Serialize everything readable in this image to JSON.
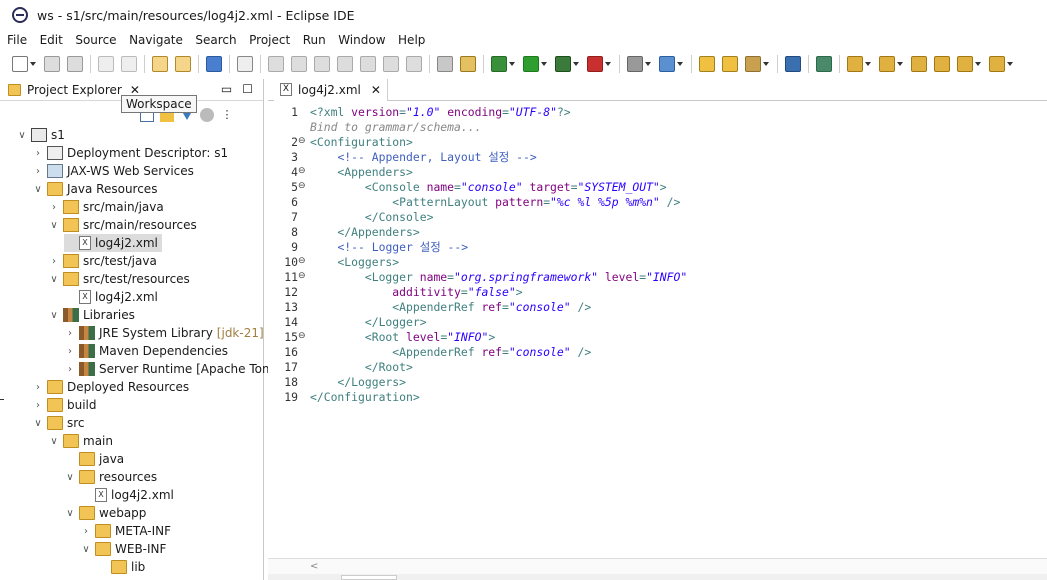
{
  "window": {
    "title": "ws - s1/src/main/resources/log4j2.xml - Eclipse IDE"
  },
  "menu": [
    "File",
    "Edit",
    "Source",
    "Navigate",
    "Search",
    "Project",
    "Run",
    "Window",
    "Help"
  ],
  "explorer": {
    "title": "Project Explorer",
    "tooltip": "Workspace"
  },
  "tree": [
    {
      "label": "s1",
      "depth": 0,
      "twisty": "v",
      "icon": "project-icon"
    },
    {
      "label": "Deployment Descriptor: s1",
      "depth": 1,
      "twisty": ">",
      "icon": "deployment-descriptor-icon"
    },
    {
      "label": "JAX-WS Web Services",
      "depth": 1,
      "twisty": ">",
      "icon": "web-services-icon"
    },
    {
      "label": "Java Resources",
      "depth": 1,
      "twisty": "v",
      "icon": "java-resources-icon"
    },
    {
      "label": "src/main/java",
      "depth": 2,
      "twisty": ">",
      "icon": "source-folder-icon"
    },
    {
      "label": "src/main/resources",
      "depth": 2,
      "twisty": "v",
      "icon": "source-folder-icon"
    },
    {
      "label": "log4j2.xml",
      "depth": 3,
      "twisty": "",
      "icon": "xml-file-icon",
      "selected": true
    },
    {
      "label": "src/test/java",
      "depth": 2,
      "twisty": ">",
      "icon": "source-folder-icon"
    },
    {
      "label": "src/test/resources",
      "depth": 2,
      "twisty": "v",
      "icon": "source-folder-icon"
    },
    {
      "label": "log4j2.xml",
      "depth": 3,
      "twisty": "",
      "icon": "xml-file-icon"
    },
    {
      "label": "Libraries",
      "depth": 2,
      "twisty": "v",
      "icon": "library-icon"
    },
    {
      "label": "JRE System Library",
      "extra": "[jdk-21]",
      "depth": 3,
      "twisty": ">",
      "icon": "library-icon"
    },
    {
      "label": "Maven Dependencies",
      "depth": 3,
      "twisty": ">",
      "icon": "library-icon"
    },
    {
      "label": "Server Runtime [Apache Tomc",
      "depth": 3,
      "twisty": ">",
      "icon": "library-icon"
    },
    {
      "label": "Deployed Resources",
      "depth": 1,
      "twisty": ">",
      "icon": "folder-icon"
    },
    {
      "label": "build",
      "depth": 1,
      "twisty": ">",
      "icon": "folder-icon"
    },
    {
      "label": "src",
      "depth": 1,
      "twisty": "v",
      "icon": "folder-icon"
    },
    {
      "label": "main",
      "depth": 2,
      "twisty": "v",
      "icon": "folder-icon"
    },
    {
      "label": "java",
      "depth": 3,
      "twisty": "",
      "icon": "folder-icon"
    },
    {
      "label": "resources",
      "depth": 3,
      "twisty": "v",
      "icon": "folder-icon"
    },
    {
      "label": "log4j2.xml",
      "depth": 4,
      "twisty": "",
      "icon": "xml-file-icon"
    },
    {
      "label": "webapp",
      "depth": 3,
      "twisty": "v",
      "icon": "folder-icon"
    },
    {
      "label": "META-INF",
      "depth": 4,
      "twisty": ">",
      "icon": "folder-icon"
    },
    {
      "label": "WEB-INF",
      "depth": 4,
      "twisty": "v",
      "icon": "folder-icon"
    },
    {
      "label": "lib",
      "depth": 5,
      "twisty": "",
      "icon": "folder-icon"
    }
  ],
  "editor": {
    "tab": "log4j2.xml",
    "lines": [
      {
        "n": "1",
        "fold": "",
        "parts": [
          [
            "tag",
            "<?"
          ],
          [
            "tag",
            "xml "
          ],
          [
            "attr",
            "version"
          ],
          [
            "tag",
            "="
          ],
          [
            "val",
            "\"1.0\""
          ],
          [
            "tag",
            " "
          ],
          [
            "attr",
            "encoding"
          ],
          [
            "tag",
            "="
          ],
          [
            "val",
            "\"UTF-8\""
          ],
          [
            "tag",
            "?>"
          ]
        ]
      },
      {
        "n": "",
        "fold": "",
        "parts": [
          [
            "hint",
            "Bind to grammar/schema..."
          ]
        ]
      },
      {
        "n": "2",
        "fold": "⊖",
        "parts": [
          [
            "tag",
            "<Configuration>"
          ]
        ]
      },
      {
        "n": "3",
        "fold": "",
        "parts": [
          [
            "tag",
            "    "
          ],
          [
            "com",
            "<!-- Appender, Layout 설정 -->"
          ]
        ]
      },
      {
        "n": "4",
        "fold": "⊖",
        "parts": [
          [
            "tag",
            "    <Appenders>"
          ]
        ]
      },
      {
        "n": "5",
        "fold": "⊖",
        "parts": [
          [
            "tag",
            "        <Console "
          ],
          [
            "attr",
            "name"
          ],
          [
            "tag",
            "="
          ],
          [
            "val",
            "\"console\""
          ],
          [
            "tag",
            " "
          ],
          [
            "attr",
            "target"
          ],
          [
            "tag",
            "="
          ],
          [
            "val",
            "\"SYSTEM_OUT\""
          ],
          [
            "tag",
            ">"
          ]
        ]
      },
      {
        "n": "6",
        "fold": "",
        "parts": [
          [
            "tag",
            "            <PatternLayout "
          ],
          [
            "attr",
            "pattern"
          ],
          [
            "tag",
            "="
          ],
          [
            "val",
            "\"%c %l %5p %m%n\""
          ],
          [
            "tag",
            " />"
          ]
        ]
      },
      {
        "n": "7",
        "fold": "",
        "parts": [
          [
            "tag",
            "        </Console>"
          ]
        ]
      },
      {
        "n": "8",
        "fold": "",
        "parts": [
          [
            "tag",
            "    </Appenders>"
          ]
        ]
      },
      {
        "n": "9",
        "fold": "",
        "parts": [
          [
            "tag",
            "    "
          ],
          [
            "com",
            "<!-- Logger 설정 -->"
          ]
        ]
      },
      {
        "n": "10",
        "fold": "⊖",
        "parts": [
          [
            "tag",
            "    <Loggers>"
          ]
        ]
      },
      {
        "n": "11",
        "fold": "⊖",
        "parts": [
          [
            "tag",
            "        <Logger "
          ],
          [
            "attr",
            "name"
          ],
          [
            "tag",
            "="
          ],
          [
            "val",
            "\"org.springframework\""
          ],
          [
            "tag",
            " "
          ],
          [
            "attr",
            "level"
          ],
          [
            "tag",
            "="
          ],
          [
            "val",
            "\"INFO\""
          ]
        ]
      },
      {
        "n": "12",
        "fold": "",
        "parts": [
          [
            "tag",
            "            "
          ],
          [
            "attr",
            "additivity"
          ],
          [
            "tag",
            "="
          ],
          [
            "val",
            "\"false\""
          ],
          [
            "tag",
            ">"
          ]
        ]
      },
      {
        "n": "13",
        "fold": "",
        "parts": [
          [
            "tag",
            "            <AppenderRef "
          ],
          [
            "attr",
            "ref"
          ],
          [
            "tag",
            "="
          ],
          [
            "val",
            "\"console\""
          ],
          [
            "tag",
            " />"
          ]
        ]
      },
      {
        "n": "14",
        "fold": "",
        "parts": [
          [
            "tag",
            "        </Logger>"
          ]
        ]
      },
      {
        "n": "15",
        "fold": "⊖",
        "parts": [
          [
            "tag",
            "        <Root "
          ],
          [
            "attr",
            "level"
          ],
          [
            "tag",
            "="
          ],
          [
            "val",
            "\"INFO\""
          ],
          [
            "tag",
            ">"
          ]
        ]
      },
      {
        "n": "16",
        "fold": "",
        "parts": [
          [
            "tag",
            "            <AppenderRef "
          ],
          [
            "attr",
            "ref"
          ],
          [
            "tag",
            "="
          ],
          [
            "val",
            "\"console\""
          ],
          [
            "tag",
            " />"
          ]
        ]
      },
      {
        "n": "17",
        "fold": "",
        "parts": [
          [
            "tag",
            "        </Root>"
          ]
        ]
      },
      {
        "n": "18",
        "fold": "",
        "parts": [
          [
            "tag",
            "    </Loggers>"
          ]
        ]
      },
      {
        "n": "19",
        "fold": "",
        "parts": [
          [
            "tag",
            "</Configuration>"
          ]
        ]
      }
    ]
  },
  "colors": {
    "tag": "#3f7f7f",
    "attr": "#7f007f",
    "value": "#2a00ff",
    "comment": "#3f5fbf"
  }
}
